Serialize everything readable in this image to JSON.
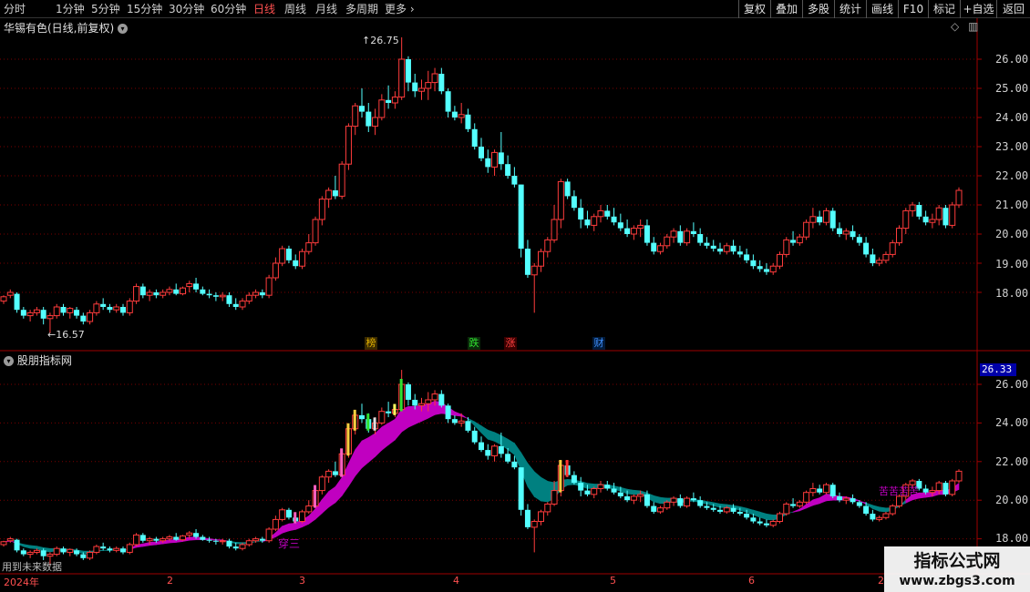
{
  "toolbar": {
    "periods": [
      "分时",
      "1分钟",
      "5分钟",
      "15分钟",
      "30分钟",
      "60分钟",
      "日线",
      "周线",
      "月线",
      "多周期",
      "更多"
    ],
    "active_period": "日线",
    "right_buttons": [
      "复权",
      "叠加",
      "多股",
      "统计",
      "画线",
      "F10",
      "标记",
      "+自选",
      "返回"
    ]
  },
  "main": {
    "title": "华锡有色(日线,前复权)",
    "high_label": "26.75",
    "low_label": "16.57",
    "events": [
      {
        "label": "榜",
        "color": "#e0b000",
        "bg": "#3a2a00"
      },
      {
        "label": "跌",
        "color": "#30e030",
        "bg": "#0a2a0a"
      },
      {
        "label": "涨",
        "color": "#ff4040",
        "bg": "#3a0000"
      },
      {
        "label": "财",
        "color": "#4090ff",
        "bg": "#001a3a"
      }
    ],
    "y_ticks": [
      "26.00",
      "25.00",
      "24.00",
      "23.00",
      "22.00",
      "21.00",
      "20.00",
      "19.00",
      "18.00"
    ]
  },
  "indicator": {
    "title": "股朋指标网",
    "current_value": "26.33",
    "y_ticks": [
      "26.00",
      "24.00",
      "22.00",
      "20.00",
      "18.00"
    ],
    "marks": {
      "chuan_san": "穿三",
      "bottom_note": "用到未来数据",
      "right_note": "苦苦苦苦"
    }
  },
  "x_axis": [
    "2024年",
    "2",
    "3",
    "4",
    "5",
    "6",
    "2"
  ],
  "watermark": {
    "line1": "指标公式网",
    "line2": "www.zbgs3.com"
  },
  "colors": {
    "up": "#ff3c3c",
    "down": "#54ffff",
    "ribbon_up": "#c000c0",
    "ribbon_down": "#008080",
    "grid": "#7a0000",
    "border": "#a00000"
  },
  "chart_data": {
    "type": "candlestick",
    "title": "华锡有色(日线,前复权)",
    "x_labels": [
      "2024年",
      "2",
      "3",
      "4",
      "5",
      "6"
    ],
    "ylim": [
      17.2,
      26.9
    ],
    "candles": [
      [
        17.7,
        17.9,
        17.6,
        17.85
      ],
      [
        17.9,
        18.1,
        17.8,
        18.0
      ],
      [
        17.95,
        18.0,
        17.3,
        17.4
      ],
      [
        17.4,
        17.5,
        17.1,
        17.2
      ],
      [
        17.2,
        17.4,
        17.0,
        17.3
      ],
      [
        17.3,
        17.5,
        17.2,
        17.4
      ],
      [
        17.4,
        17.5,
        16.9,
        17.1
      ],
      [
        17.1,
        17.3,
        16.6,
        17.2
      ],
      [
        17.2,
        17.6,
        17.1,
        17.5
      ],
      [
        17.5,
        17.6,
        17.2,
        17.3
      ],
      [
        17.3,
        17.5,
        17.1,
        17.45
      ],
      [
        17.4,
        17.5,
        17.1,
        17.2
      ],
      [
        17.2,
        17.3,
        16.9,
        17.0
      ],
      [
        17.0,
        17.4,
        16.9,
        17.3
      ],
      [
        17.3,
        17.7,
        17.2,
        17.6
      ],
      [
        17.6,
        17.8,
        17.4,
        17.5
      ],
      [
        17.5,
        17.6,
        17.3,
        17.4
      ],
      [
        17.4,
        17.6,
        17.3,
        17.5
      ],
      [
        17.5,
        17.6,
        17.2,
        17.3
      ],
      [
        17.3,
        17.8,
        17.2,
        17.7
      ],
      [
        17.7,
        18.3,
        17.6,
        18.2
      ],
      [
        18.2,
        18.3,
        17.8,
        17.9
      ],
      [
        17.9,
        18.1,
        17.7,
        18.0
      ],
      [
        18.0,
        18.1,
        17.8,
        17.9
      ],
      [
        17.9,
        18.1,
        17.8,
        18.0
      ],
      [
        18.0,
        18.2,
        17.9,
        18.1
      ],
      [
        18.1,
        18.3,
        17.9,
        17.95
      ],
      [
        17.95,
        18.2,
        17.9,
        18.15
      ],
      [
        18.2,
        18.4,
        18.0,
        18.3
      ],
      [
        18.3,
        18.5,
        18.0,
        18.1
      ],
      [
        18.1,
        18.2,
        17.9,
        17.95
      ],
      [
        17.95,
        18.1,
        17.8,
        17.9
      ],
      [
        17.9,
        18.0,
        17.7,
        17.85
      ],
      [
        17.85,
        18.0,
        17.7,
        17.9
      ],
      [
        17.9,
        18.0,
        17.5,
        17.6
      ],
      [
        17.6,
        17.8,
        17.4,
        17.5
      ],
      [
        17.5,
        17.8,
        17.4,
        17.7
      ],
      [
        17.7,
        18.0,
        17.6,
        17.9
      ],
      [
        17.9,
        18.1,
        17.8,
        18.0
      ],
      [
        18.0,
        18.1,
        17.8,
        17.9
      ],
      [
        17.9,
        18.6,
        17.8,
        18.5
      ],
      [
        18.5,
        19.2,
        18.4,
        19.0
      ],
      [
        19.0,
        19.6,
        18.9,
        19.5
      ],
      [
        19.5,
        19.6,
        19.0,
        19.1
      ],
      [
        19.1,
        19.3,
        18.8,
        18.9
      ],
      [
        18.9,
        19.5,
        18.8,
        19.4
      ],
      [
        19.4,
        20.0,
        19.3,
        19.7
      ],
      [
        19.7,
        20.6,
        19.6,
        20.5
      ],
      [
        20.5,
        21.3,
        20.3,
        21.2
      ],
      [
        21.2,
        21.6,
        20.9,
        21.5
      ],
      [
        21.5,
        22.0,
        21.2,
        21.3
      ],
      [
        21.3,
        22.5,
        21.2,
        22.4
      ],
      [
        22.4,
        23.8,
        22.2,
        23.7
      ],
      [
        23.7,
        24.5,
        23.4,
        24.4
      ],
      [
        24.4,
        25.0,
        24.0,
        24.2
      ],
      [
        24.2,
        24.5,
        23.5,
        23.7
      ],
      [
        23.7,
        24.3,
        23.4,
        24.0
      ],
      [
        24.0,
        24.8,
        23.9,
        24.6
      ],
      [
        24.6,
        25.1,
        24.3,
        24.5
      ],
      [
        24.5,
        24.9,
        24.3,
        24.7
      ],
      [
        24.7,
        26.75,
        24.6,
        26.0
      ],
      [
        26.0,
        26.1,
        24.9,
        25.2
      ],
      [
        25.2,
        25.5,
        24.7,
        24.9
      ],
      [
        24.9,
        25.3,
        24.6,
        25.0
      ],
      [
        25.0,
        25.6,
        24.6,
        25.2
      ],
      [
        25.2,
        25.7,
        24.9,
        25.5
      ],
      [
        25.5,
        25.7,
        24.8,
        24.9
      ],
      [
        24.9,
        25.0,
        24.0,
        24.2
      ],
      [
        24.2,
        24.4,
        23.9,
        24.0
      ],
      [
        24.0,
        24.5,
        23.8,
        24.1
      ],
      [
        24.1,
        24.3,
        23.5,
        23.6
      ],
      [
        23.6,
        23.8,
        22.9,
        23.0
      ],
      [
        23.0,
        23.3,
        22.5,
        22.6
      ],
      [
        22.6,
        22.9,
        22.1,
        22.3
      ],
      [
        22.3,
        22.9,
        22.0,
        22.8
      ],
      [
        22.8,
        23.5,
        22.2,
        22.4
      ],
      [
        22.4,
        22.7,
        21.9,
        22.0
      ],
      [
        22.0,
        22.3,
        21.6,
        21.7
      ],
      [
        21.7,
        21.7,
        19.2,
        19.5
      ],
      [
        19.5,
        19.8,
        18.5,
        18.6
      ],
      [
        18.6,
        19.0,
        17.3,
        18.9
      ],
      [
        18.9,
        19.5,
        18.7,
        19.4
      ],
      [
        19.4,
        19.9,
        19.2,
        19.8
      ],
      [
        19.8,
        21.0,
        19.7,
        20.5
      ],
      [
        20.5,
        21.9,
        20.2,
        21.8
      ],
      [
        21.8,
        21.9,
        21.2,
        21.3
      ],
      [
        21.3,
        21.5,
        20.8,
        20.9
      ],
      [
        20.9,
        21.2,
        20.2,
        20.5
      ],
      [
        20.5,
        20.8,
        20.2,
        20.3
      ],
      [
        20.3,
        20.7,
        20.1,
        20.6
      ],
      [
        20.6,
        21.0,
        20.4,
        20.8
      ],
      [
        20.8,
        21.0,
        20.5,
        20.6
      ],
      [
        20.6,
        20.9,
        20.3,
        20.4
      ],
      [
        20.4,
        20.7,
        20.1,
        20.2
      ],
      [
        20.2,
        20.5,
        19.9,
        20.0
      ],
      [
        20.0,
        20.3,
        19.8,
        20.2
      ],
      [
        20.2,
        20.5,
        19.9,
        20.3
      ],
      [
        20.3,
        20.5,
        19.6,
        19.7
      ],
      [
        19.7,
        19.9,
        19.3,
        19.4
      ],
      [
        19.4,
        19.7,
        19.3,
        19.6
      ],
      [
        19.6,
        20.0,
        19.5,
        19.9
      ],
      [
        19.9,
        20.2,
        19.7,
        20.1
      ],
      [
        20.1,
        20.3,
        19.6,
        19.7
      ],
      [
        19.7,
        20.2,
        19.6,
        20.1
      ],
      [
        20.1,
        20.4,
        19.9,
        20.0
      ],
      [
        20.0,
        20.2,
        19.6,
        19.7
      ],
      [
        19.7,
        19.9,
        19.5,
        19.6
      ],
      [
        19.6,
        19.8,
        19.4,
        19.5
      ],
      [
        19.5,
        19.7,
        19.3,
        19.4
      ],
      [
        19.4,
        19.7,
        19.3,
        19.6
      ],
      [
        19.6,
        19.8,
        19.3,
        19.4
      ],
      [
        19.4,
        19.6,
        19.2,
        19.3
      ],
      [
        19.3,
        19.5,
        19.0,
        19.1
      ],
      [
        19.1,
        19.3,
        18.8,
        18.9
      ],
      [
        18.9,
        19.1,
        18.7,
        18.8
      ],
      [
        18.8,
        19.0,
        18.6,
        18.7
      ],
      [
        18.7,
        19.0,
        18.6,
        18.9
      ],
      [
        18.9,
        19.4,
        18.8,
        19.3
      ],
      [
        19.3,
        19.9,
        19.2,
        19.8
      ],
      [
        19.8,
        20.1,
        19.6,
        19.7
      ],
      [
        19.7,
        20.0,
        19.6,
        19.9
      ],
      [
        19.9,
        20.5,
        19.8,
        20.4
      ],
      [
        20.4,
        20.9,
        20.2,
        20.6
      ],
      [
        20.6,
        20.8,
        20.3,
        20.4
      ],
      [
        20.4,
        20.9,
        20.3,
        20.8
      ],
      [
        20.8,
        20.9,
        20.1,
        20.2
      ],
      [
        20.2,
        20.4,
        19.9,
        20.0
      ],
      [
        20.0,
        20.2,
        19.8,
        20.1
      ],
      [
        20.1,
        20.3,
        19.8,
        19.9
      ],
      [
        19.9,
        20.0,
        19.6,
        19.7
      ],
      [
        19.7,
        19.9,
        19.2,
        19.3
      ],
      [
        19.3,
        19.5,
        18.9,
        19.0
      ],
      [
        19.0,
        19.2,
        18.9,
        19.1
      ],
      [
        19.1,
        19.4,
        19.0,
        19.3
      ],
      [
        19.3,
        19.8,
        19.2,
        19.7
      ],
      [
        19.7,
        20.3,
        19.6,
        20.2
      ],
      [
        20.2,
        20.9,
        20.0,
        20.8
      ],
      [
        20.8,
        21.1,
        20.6,
        21.0
      ],
      [
        21.0,
        21.1,
        20.5,
        20.6
      ],
      [
        20.6,
        20.8,
        20.3,
        20.4
      ],
      [
        20.4,
        20.7,
        20.2,
        20.5
      ],
      [
        20.5,
        21.0,
        20.3,
        20.9
      ],
      [
        20.9,
        21.0,
        20.2,
        20.3
      ],
      [
        20.3,
        21.1,
        20.2,
        21.0
      ],
      [
        21.0,
        21.6,
        20.9,
        21.5
      ]
    ]
  }
}
